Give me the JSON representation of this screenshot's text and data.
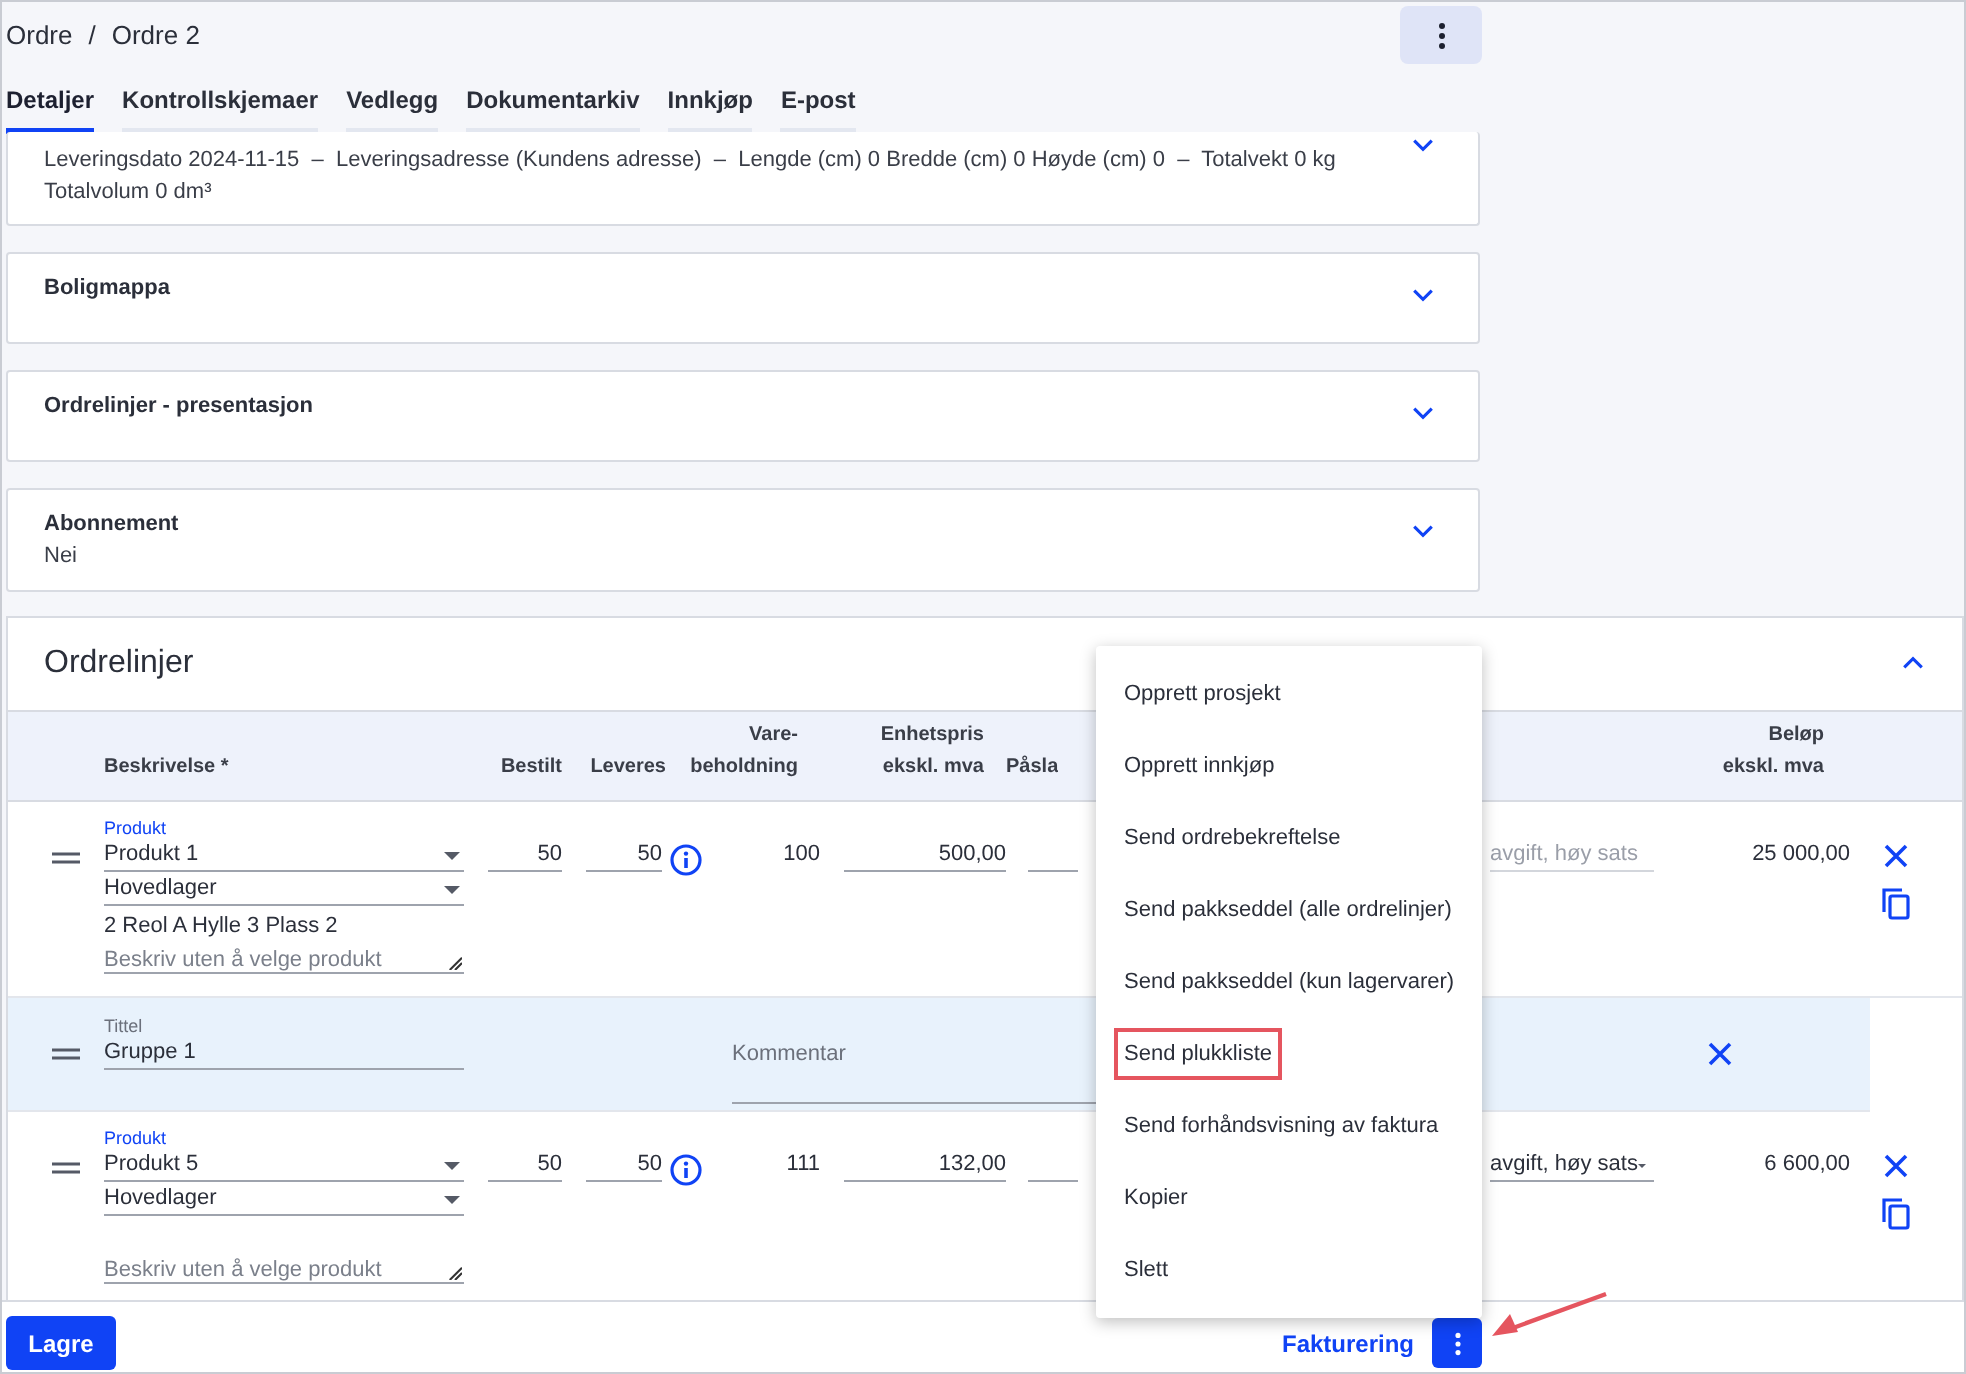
{
  "breadcrumb": {
    "parent": "Ordre",
    "separator": "/",
    "current": "Ordre 2"
  },
  "tabs": [
    {
      "label": "Detaljer",
      "selected": true
    },
    {
      "label": "Kontrollskjemaer",
      "selected": false
    },
    {
      "label": "Vedlegg",
      "selected": false
    },
    {
      "label": "Dokumentarkiv",
      "selected": false
    },
    {
      "label": "Innkjøp",
      "selected": false
    },
    {
      "label": "E-post",
      "selected": false
    }
  ],
  "sections": [
    {
      "lines": [
        "Leveringsdato 2024-11-15  –  Leveringsadresse (Kundens adresse)  –  Lengde (cm) 0 Bredde (cm) 0 Høyde (cm) 0  –  Totalvekt 0 kg",
        "Totalvolum 0 dm³"
      ],
      "expanded": false
    },
    {
      "title": "Boligmappa",
      "expanded": false
    },
    {
      "title": "Ordrelinjer - presentasjon",
      "expanded": false
    },
    {
      "title": "Abonnement",
      "lines": [
        "Nei"
      ],
      "expanded": false
    }
  ],
  "order_lines": {
    "title": "Ordrelinjer",
    "expanded": true,
    "columns": [
      {
        "lines": [
          "Beskrivelse *"
        ]
      },
      {
        "lines": [
          "Bestilt"
        ]
      },
      {
        "lines": [
          "Leveres"
        ]
      },
      {
        "lines": [
          "Vare-",
          "beholdning"
        ]
      },
      {
        "lines": [
          "Enhetspris",
          "ekskl. mva"
        ]
      },
      {
        "lines": [
          "Påsla"
        ]
      },
      {
        "lines": [
          "Beløp",
          "ekskl. mva"
        ]
      }
    ],
    "rows": [
      {
        "kind": "product",
        "label": "Produkt",
        "product": "Produkt 1",
        "warehouse": "Hovedlager",
        "location": "2 Reol A Hylle 3 Plass 2",
        "description_placeholder": "Beskriv uten å velge produkt",
        "ordered": "50",
        "delivered": "50",
        "stock": "100",
        "unit_price": "500,00",
        "vat": "avgift, høy sats",
        "vat_disabled": true,
        "amount": "25 000,00"
      },
      {
        "kind": "group",
        "title_label": "Tittel",
        "title": "Gruppe 1",
        "comment_placeholder": "Kommentar"
      },
      {
        "kind": "product",
        "label": "Produkt",
        "product": "Produkt 5",
        "warehouse": "Hovedlager",
        "description_placeholder": "Beskriv uten å velge produkt",
        "ordered": "50",
        "delivered": "50",
        "stock": "111",
        "unit_price": "132,00",
        "vat": "avgift, høy sats",
        "vat_disabled": false,
        "amount": "6 600,00"
      }
    ]
  },
  "menu": {
    "items": [
      {
        "label": "Opprett prosjekt",
        "annotated": false
      },
      {
        "label": "Opprett innkjøp",
        "annotated": false
      },
      {
        "label": "Send ordrebekreftelse",
        "annotated": false
      },
      {
        "label": "Send pakkseddel (alle ordrelinjer)",
        "annotated": false
      },
      {
        "label": "Send pakkseddel (kun lagervarer)",
        "annotated": false
      },
      {
        "label": "Send plukkliste",
        "annotated": true
      },
      {
        "label": "Send forhåndsvisning av faktura",
        "annotated": false
      },
      {
        "label": "Kopier",
        "annotated": false
      },
      {
        "label": "Slett",
        "annotated": false
      }
    ]
  },
  "footer": {
    "save": "Lagre",
    "invoicing": "Fakturering"
  }
}
